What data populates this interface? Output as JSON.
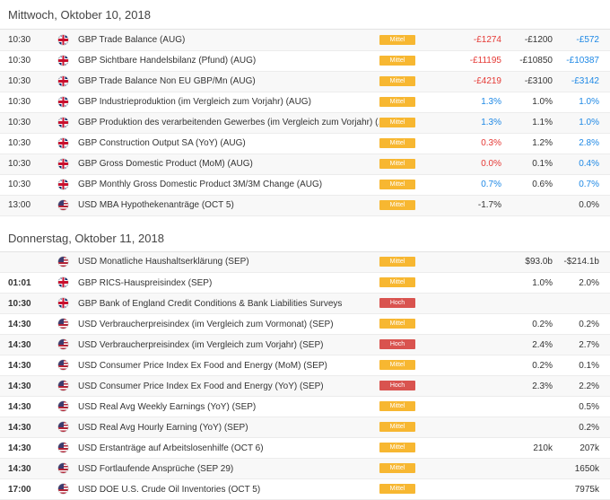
{
  "days": [
    {
      "header": "Mittwoch, Oktober 10, 2018",
      "rows": [
        {
          "time": "10:30",
          "bold": false,
          "flag": "uk-flag-icon",
          "event": "GBP Trade Balance (AUG)",
          "importance": "Mittel",
          "actual": "-£1274",
          "actual_color": "red",
          "forecast": "-£1200",
          "previous": "-£572",
          "previous_color": "blue"
        },
        {
          "time": "10:30",
          "bold": false,
          "flag": "uk-flag-icon",
          "event": "GBP Sichtbare Handelsbilanz (Pfund) (AUG)",
          "importance": "Mittel",
          "actual": "-£11195",
          "actual_color": "red",
          "forecast": "-£10850",
          "previous": "-£10387",
          "previous_color": "blue"
        },
        {
          "time": "10:30",
          "bold": false,
          "flag": "uk-flag-icon",
          "event": "GBP Trade Balance Non EU GBP/Mn (AUG)",
          "importance": "Mittel",
          "actual": "-£4219",
          "actual_color": "red",
          "forecast": "-£3100",
          "previous": "-£3142",
          "previous_color": "blue"
        },
        {
          "time": "10:30",
          "bold": false,
          "flag": "uk-flag-icon",
          "event": "GBP Industrieproduktion (im Vergleich zum Vorjahr) (AUG)",
          "importance": "Mittel",
          "actual": "1.3%",
          "actual_color": "blue",
          "forecast": "1.0%",
          "previous": "1.0%",
          "previous_color": "blue"
        },
        {
          "time": "10:30",
          "bold": false,
          "flag": "uk-flag-icon",
          "event": "GBP Produktion des verarbeitenden Gewerbes (im Vergleich zum Vorjahr) (AUG)",
          "importance": "Mittel",
          "actual": "1.3%",
          "actual_color": "blue",
          "forecast": "1.1%",
          "previous": "1.0%",
          "previous_color": "blue"
        },
        {
          "time": "10:30",
          "bold": false,
          "flag": "uk-flag-icon",
          "event": "GBP Construction Output SA (YoY) (AUG)",
          "importance": "Mittel",
          "actual": "0.3%",
          "actual_color": "red",
          "forecast": "1.2%",
          "previous": "2.8%",
          "previous_color": "blue"
        },
        {
          "time": "10:30",
          "bold": false,
          "flag": "uk-flag-icon",
          "event": "GBP Gross Domestic Product (MoM) (AUG)",
          "importance": "Mittel",
          "actual": "0.0%",
          "actual_color": "red",
          "forecast": "0.1%",
          "previous": "0.4%",
          "previous_color": "blue"
        },
        {
          "time": "10:30",
          "bold": false,
          "flag": "uk-flag-icon",
          "event": "GBP Monthly Gross Domestic Product 3M/3M Change (AUG)",
          "importance": "Mittel",
          "actual": "0.7%",
          "actual_color": "blue",
          "forecast": "0.6%",
          "previous": "0.7%",
          "previous_color": "blue"
        },
        {
          "time": "13:00",
          "bold": false,
          "flag": "us-flag-icon",
          "event": "USD MBA Hypothekenanträge (OCT 5)",
          "importance": "Mittel",
          "actual": "-1.7%",
          "actual_color": "dark",
          "forecast": "",
          "previous": "0.0%",
          "previous_color": "dark"
        }
      ]
    },
    {
      "header": "Donnerstag, Oktober 11, 2018",
      "rows": [
        {
          "time": "",
          "bold": true,
          "flag": "us-flag-icon",
          "event": "USD Monatliche Haushaltserklärung (SEP)",
          "importance": "Mittel",
          "actual": "",
          "actual_color": "dark",
          "forecast": "$93.0b",
          "previous": "-$214.1b",
          "previous_color": "dark"
        },
        {
          "time": "01:01",
          "bold": true,
          "flag": "uk-flag-icon",
          "event": "GBP RICS-Hauspreisindex (SEP)",
          "importance": "Mittel",
          "actual": "",
          "actual_color": "dark",
          "forecast": "1.0%",
          "previous": "2.0%",
          "previous_color": "dark"
        },
        {
          "time": "10:30",
          "bold": true,
          "flag": "uk-flag-icon",
          "event": "GBP Bank of England Credit Conditions & Bank Liabilities Surveys",
          "importance": "Hoch",
          "actual": "",
          "actual_color": "dark",
          "forecast": "",
          "previous": "",
          "previous_color": "dark"
        },
        {
          "time": "14:30",
          "bold": true,
          "flag": "us-flag-icon",
          "event": "USD Verbraucherpreisindex (im Vergleich zum Vormonat) (SEP)",
          "importance": "Mittel",
          "actual": "",
          "actual_color": "dark",
          "forecast": "0.2%",
          "previous": "0.2%",
          "previous_color": "dark"
        },
        {
          "time": "14:30",
          "bold": true,
          "flag": "us-flag-icon",
          "event": "USD Verbraucherpreisindex (im Vergleich zum Vorjahr) (SEP)",
          "importance": "Hoch",
          "actual": "",
          "actual_color": "dark",
          "forecast": "2.4%",
          "previous": "2.7%",
          "previous_color": "dark"
        },
        {
          "time": "14:30",
          "bold": true,
          "flag": "us-flag-icon",
          "event": "USD Consumer Price Index Ex Food and Energy (MoM) (SEP)",
          "importance": "Mittel",
          "actual": "",
          "actual_color": "dark",
          "forecast": "0.2%",
          "previous": "0.1%",
          "previous_color": "dark"
        },
        {
          "time": "14:30",
          "bold": true,
          "flag": "us-flag-icon",
          "event": "USD Consumer Price Index Ex Food and Energy (YoY) (SEP)",
          "importance": "Hoch",
          "actual": "",
          "actual_color": "dark",
          "forecast": "2.3%",
          "previous": "2.2%",
          "previous_color": "dark"
        },
        {
          "time": "14:30",
          "bold": true,
          "flag": "us-flag-icon",
          "event": "USD Real Avg Weekly Earnings (YoY) (SEP)",
          "importance": "Mittel",
          "actual": "",
          "actual_color": "dark",
          "forecast": "",
          "previous": "0.5%",
          "previous_color": "dark"
        },
        {
          "time": "14:30",
          "bold": true,
          "flag": "us-flag-icon",
          "event": "USD Real Avg Hourly Earning (YoY) (SEP)",
          "importance": "Mittel",
          "actual": "",
          "actual_color": "dark",
          "forecast": "",
          "previous": "0.2%",
          "previous_color": "dark"
        },
        {
          "time": "14:30",
          "bold": true,
          "flag": "us-flag-icon",
          "event": "USD Erstanträge auf Arbeitslosenhilfe (OCT 6)",
          "importance": "Mittel",
          "actual": "",
          "actual_color": "dark",
          "forecast": "210k",
          "previous": "207k",
          "previous_color": "dark"
        },
        {
          "time": "14:30",
          "bold": true,
          "flag": "us-flag-icon",
          "event": "USD Fortlaufende Ansprüche (SEP 29)",
          "importance": "Mittel",
          "actual": "",
          "actual_color": "dark",
          "forecast": "",
          "previous": "1650k",
          "previous_color": "dark"
        },
        {
          "time": "17:00",
          "bold": true,
          "flag": "us-flag-icon",
          "event": "USD DOE U.S. Crude Oil Inventories (OCT 5)",
          "importance": "Mittel",
          "actual": "",
          "actual_color": "dark",
          "forecast": "",
          "previous": "7975k",
          "previous_color": "dark"
        }
      ]
    }
  ]
}
